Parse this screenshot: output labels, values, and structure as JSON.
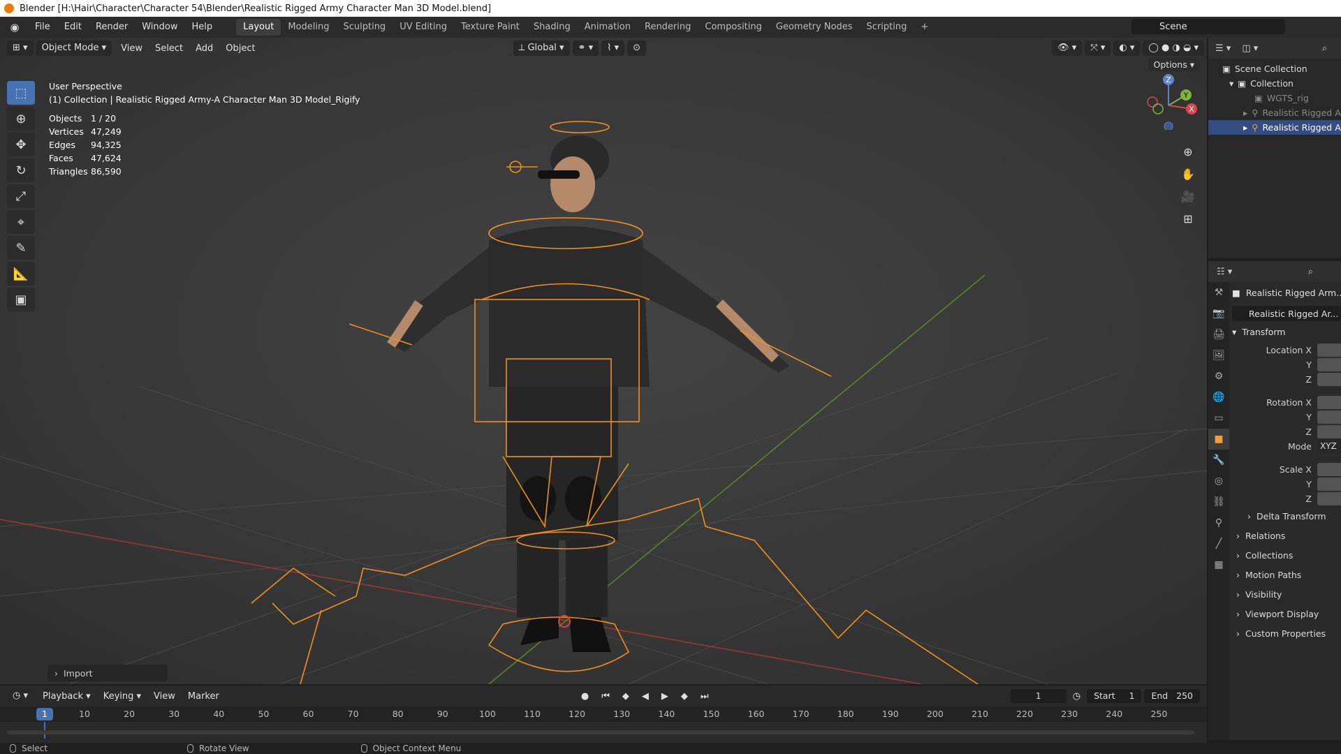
{
  "window": {
    "title": "Blender [H:\\Hair\\Character\\Character 54\\Blender\\Realistic Rigged Army Character Man 3D Model.blend]"
  },
  "menubar": {
    "menus": [
      "File",
      "Edit",
      "Render",
      "Window",
      "Help"
    ],
    "workspaces": [
      "Layout",
      "Modeling",
      "Sculpting",
      "UV Editing",
      "Texture Paint",
      "Shading",
      "Animation",
      "Rendering",
      "Compositing",
      "Geometry Nodes",
      "Scripting"
    ],
    "active_workspace": "Layout",
    "scene": "Scene"
  },
  "viewport": {
    "mode": "Object Mode",
    "menus": [
      "View",
      "Select",
      "Add",
      "Object"
    ],
    "orientation": "Global",
    "options_label": "Options",
    "perspective_label": "User Perspective",
    "collection_label": "(1) Collection | Realistic Rigged Army-A Character Man 3D Model_Rigify",
    "stats": [
      {
        "key": "Objects",
        "value": "1 / 20"
      },
      {
        "key": "Vertices",
        "value": "47,249"
      },
      {
        "key": "Edges",
        "value": "94,325"
      },
      {
        "key": "Faces",
        "value": "47,624"
      },
      {
        "key": "Triangles",
        "value": "86,590"
      }
    ],
    "gizmo": {
      "z": "Z",
      "y": "Y",
      "x": "X"
    },
    "import_label": "Import"
  },
  "outliner": {
    "items": [
      {
        "label": "Scene Collection",
        "indent": 0,
        "state": "normal"
      },
      {
        "label": "Collection",
        "indent": 1,
        "state": "normal"
      },
      {
        "label": "WGTS_rig",
        "indent": 2,
        "state": "dim"
      },
      {
        "label": "Realistic Rigged Arm",
        "indent": 2,
        "state": "dim"
      },
      {
        "label": "Realistic Rigged Arm",
        "indent": 2,
        "state": "selected"
      }
    ]
  },
  "properties": {
    "object_name": "Realistic Rigged Arm...",
    "data_name": "Realistic Rigged Ar...",
    "transform_label": "Transform",
    "location": [
      "Location X",
      "Y",
      "Z"
    ],
    "rotation": [
      "Rotation X",
      "Y",
      "Z"
    ],
    "mode_label": "Mode",
    "mode_value": "XYZ",
    "scale": [
      "Scale X",
      "Y",
      "Z"
    ],
    "delta_label": "Delta Transform",
    "sections": [
      "Relations",
      "Collections",
      "Motion Paths",
      "Visibility",
      "Viewport Display",
      "Custom Properties"
    ]
  },
  "timeline": {
    "menus": [
      "Playback",
      "Keying",
      "View",
      "Marker"
    ],
    "current_frame": "1",
    "start_label": "Start",
    "start": "1",
    "end_label": "End",
    "end": "250",
    "ruler": [
      "10",
      "20",
      "30",
      "40",
      "50",
      "60",
      "70",
      "80",
      "90",
      "100",
      "110",
      "120",
      "130",
      "140",
      "150",
      "160",
      "170",
      "180",
      "190",
      "200",
      "210",
      "220",
      "230",
      "240",
      "250"
    ],
    "cursor": "1"
  },
  "statusbar": {
    "items": [
      "Select",
      "Rotate View",
      "Object Context Menu"
    ]
  }
}
